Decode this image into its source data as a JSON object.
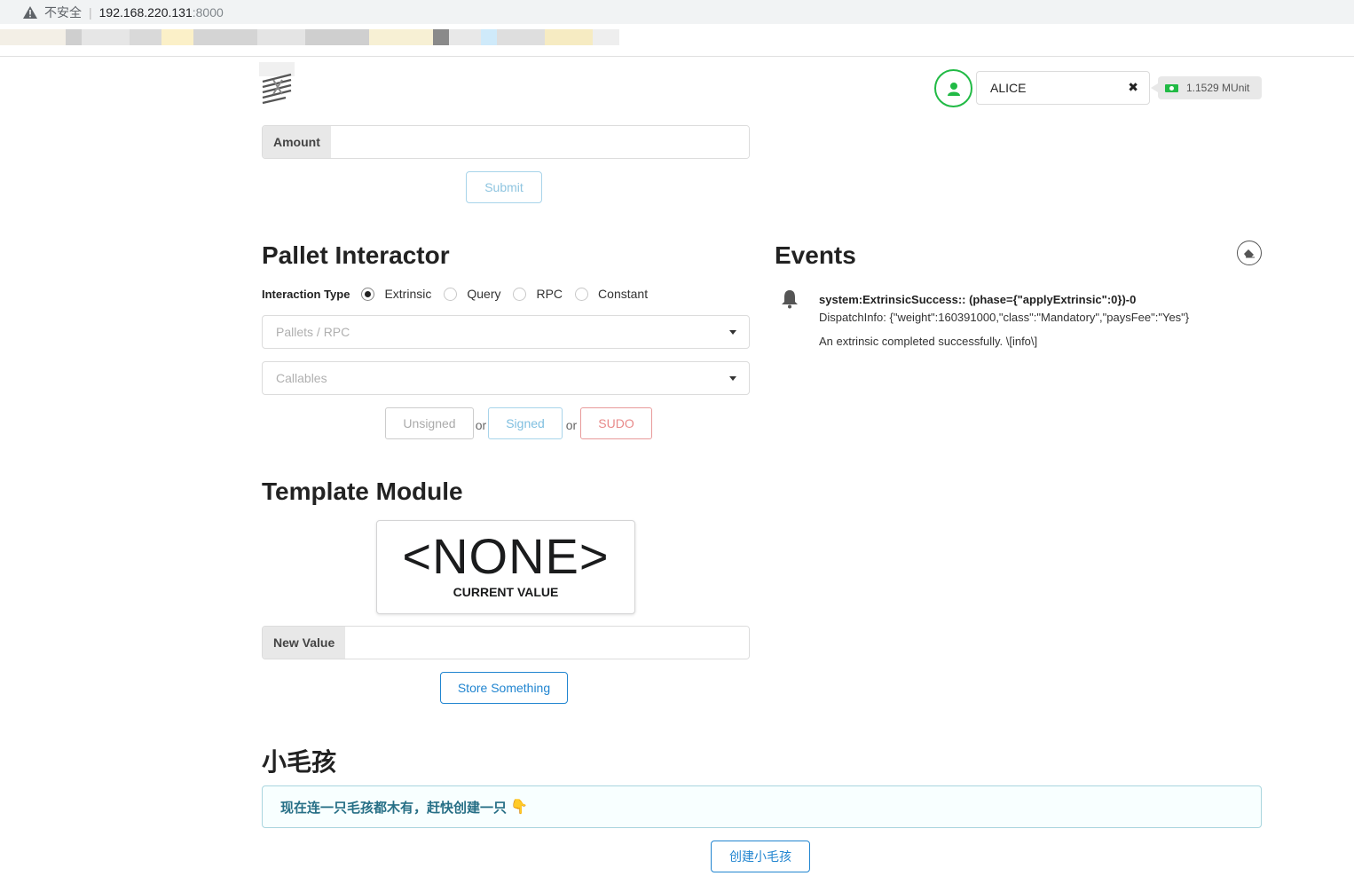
{
  "browser": {
    "insecure_label": "不安全",
    "host": "192.168.220.131",
    "port": ":8000"
  },
  "colors": {
    "primary": "#2185d0",
    "positive": "#21ba45",
    "negative": "#db2828",
    "info_text": "#276f86"
  },
  "header": {
    "account_name": "ALICE",
    "balance": "1.1529 MUnit",
    "icons": [
      "logo",
      "user-icon",
      "close-icon",
      "money-icon"
    ]
  },
  "transfer": {
    "amount_label": "Amount",
    "amount_value": "",
    "submit_label": "Submit"
  },
  "pallet_interactor": {
    "title": "Pallet Interactor",
    "interaction_type_label": "Interaction Type",
    "options": [
      "Extrinsic",
      "Query",
      "RPC",
      "Constant"
    ],
    "selected": "Extrinsic",
    "pallets_placeholder": "Pallets / RPC",
    "callables_placeholder": "Callables",
    "unsigned_label": "Unsigned",
    "or_1": "or",
    "signed_label": "Signed",
    "or_2": "or",
    "sudo_label": "SUDO"
  },
  "events": {
    "title": "Events",
    "items": [
      {
        "title": "system:ExtrinsicSuccess:: (phase={\"applyExtrinsic\":0})-0",
        "detail": "DispatchInfo: {\"weight\":160391000,\"class\":\"Mandatory\",\"paysFee\":\"Yes\"}",
        "description": "An extrinsic completed successfully. \\[info\\]"
      }
    ]
  },
  "template_module": {
    "title": "Template Module",
    "current_value": "<NONE>",
    "current_value_label": "CURRENT VALUE",
    "new_value_label": "New Value",
    "new_value": "",
    "store_label": "Store Something"
  },
  "kitties": {
    "title": "小毛孩",
    "empty_message": "现在连一只毛孩都木有，赶快创建一只",
    "create_label": "创建小毛孩"
  }
}
